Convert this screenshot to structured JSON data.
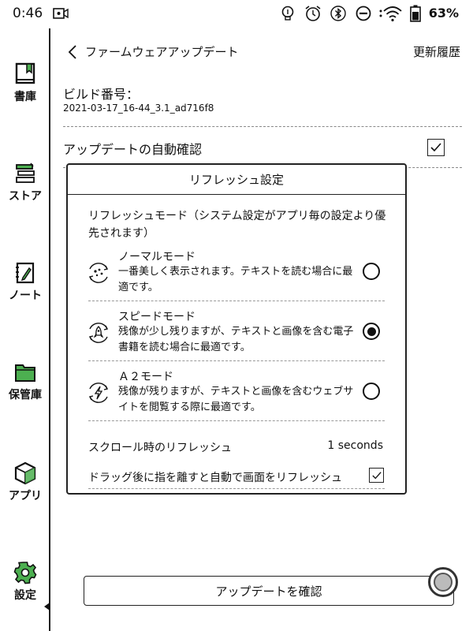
{
  "status_bar": {
    "time": "0:46",
    "battery_percent": "63%",
    "icons": [
      "video-icon",
      "bulb-icon",
      "alarm-icon",
      "bluetooth-icon",
      "minus-circle-icon",
      "wifi-icon",
      "battery-icon"
    ]
  },
  "sidebar": {
    "items": [
      {
        "label": "書庫",
        "icon": "book-icon"
      },
      {
        "label": "ストア",
        "icon": "store-icon"
      },
      {
        "label": "ノート",
        "icon": "note-icon"
      },
      {
        "label": "保管庫",
        "icon": "folder-icon"
      },
      {
        "label": "アプリ",
        "icon": "cube-icon"
      },
      {
        "label": "設定",
        "icon": "gear-icon",
        "active": true
      }
    ]
  },
  "header": {
    "title": "ファームウェアアップデート",
    "history_label": "更新履歴"
  },
  "firmware": {
    "build_label": "ビルド番号：",
    "build_value": "2021-03-17_16-44_3.1_ad716f8",
    "auto_check_label": "アップデートの自動確認",
    "auto_check_checked": true,
    "confirm_button": "アップデートを確認"
  },
  "dialog": {
    "title": "リフレッシュ設定",
    "mode_header": "リフレッシュモード（システム設定がアプリ毎の設定より優先されます）",
    "modes": [
      {
        "name": "ノーマルモード",
        "desc": "一番美しく表示されます。テキストを読む場合に最適です。",
        "selected": false
      },
      {
        "name": "スピードモード",
        "desc": "残像が少し残りますが、テキストと画像を含む電子書籍を読む場合に最適です。",
        "selected": true
      },
      {
        "name": "Ａ２モード",
        "desc": "残像が残りますが、テキストと画像を含むウェブサイトを閲覧する際に最適です。",
        "selected": false
      }
    ],
    "scroll_refresh_label": "スクロール時のリフレッシュ",
    "scroll_refresh_value": "1 seconds",
    "drag_refresh_label": "ドラッグ後に指を離すと自動で画面をリフレッシュ",
    "drag_refresh_checked": true
  },
  "colors": {
    "accent": "#4caf50",
    "ink": "#111111"
  }
}
